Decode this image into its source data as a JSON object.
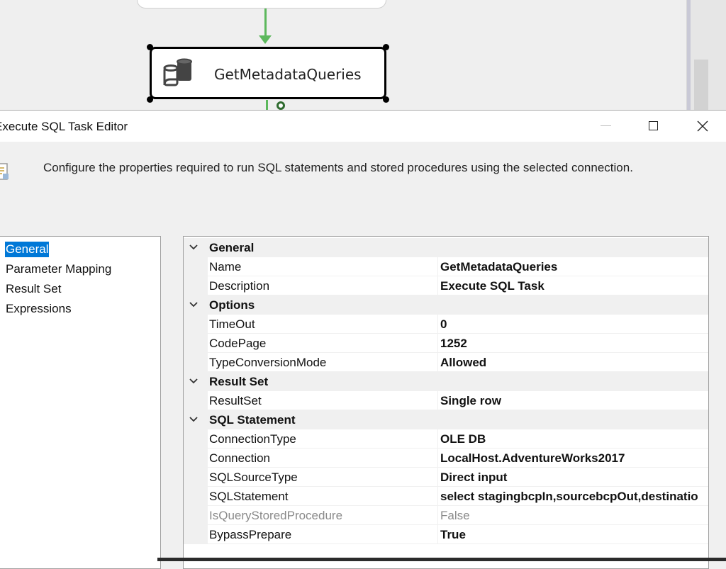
{
  "designer": {
    "task_name": "GetMetadataQueries",
    "task_icon": "execute-sql-task-icon",
    "flow_color": "#5cb85c"
  },
  "dialog": {
    "title": "Execute SQL Task Editor",
    "header_text": "Configure the properties required to run SQL statements and stored procedures using the selected connection.",
    "accent_color": "#0078d7"
  },
  "nav": {
    "items": [
      {
        "label": "General",
        "selected": true
      },
      {
        "label": "Parameter Mapping",
        "selected": false
      },
      {
        "label": "Result Set",
        "selected": false
      },
      {
        "label": "Expressions",
        "selected": false
      }
    ]
  },
  "grid": {
    "categories": [
      {
        "label": "General",
        "rows": [
          {
            "name": "Name",
            "value": "GetMetadataQueries"
          },
          {
            "name": "Description",
            "value": "Execute SQL Task"
          }
        ]
      },
      {
        "label": "Options",
        "rows": [
          {
            "name": "TimeOut",
            "value": "0"
          },
          {
            "name": "CodePage",
            "value": "1252"
          },
          {
            "name": "TypeConversionMode",
            "value": "Allowed"
          }
        ]
      },
      {
        "label": "Result Set",
        "rows": [
          {
            "name": "ResultSet",
            "value": "Single row"
          }
        ]
      },
      {
        "label": "SQL Statement",
        "rows": [
          {
            "name": "ConnectionType",
            "value": "OLE DB"
          },
          {
            "name": "Connection",
            "value": "LocalHost.AdventureWorks2017"
          },
          {
            "name": "SQLSourceType",
            "value": "Direct input"
          },
          {
            "name": "SQLStatement",
            "value": "select stagingbcpIn,sourcebcpOut,destinatio"
          },
          {
            "name": "IsQueryStoredProcedure",
            "value": "False",
            "disabled": true
          },
          {
            "name": "BypassPrepare",
            "value": "True"
          }
        ]
      }
    ]
  }
}
